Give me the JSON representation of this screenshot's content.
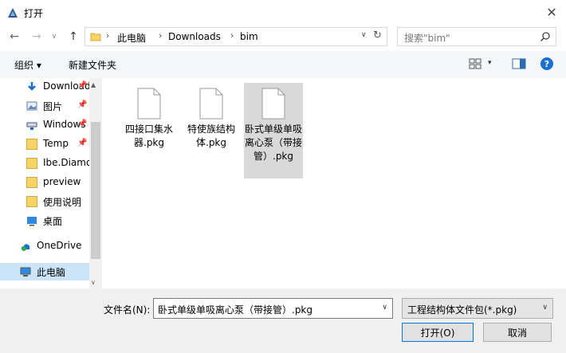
{
  "window": {
    "title": "打开",
    "close_glyph": "✕"
  },
  "nav": {
    "back_glyph": "←",
    "forward_glyph": "→",
    "history_glyph": "∨",
    "up_glyph": "↑",
    "breadcrumb": [
      "此电脑",
      "Downloads",
      "bim"
    ],
    "separator": "›",
    "dropdown_glyph": "∨",
    "refresh_glyph": "↻",
    "search_placeholder": "搜索\"bim\""
  },
  "toolbar": {
    "organize_label": "组织 ▾",
    "new_folder_label": "新建文件夹",
    "view_dropdown_glyph": "▾",
    "help_label": "?"
  },
  "sidebar": {
    "scroll_up_glyph": "▲",
    "scroll_down_glyph": "∨",
    "items": [
      {
        "label": "Downloads",
        "icon": "download-arrow-icon",
        "pinned": true
      },
      {
        "label": "图片",
        "icon": "pictures-icon",
        "pinned": true
      },
      {
        "label": "Windows",
        "icon": "network-drive-icon",
        "pinned": true
      },
      {
        "label": "Temp",
        "icon": "folder-icon",
        "pinned": true
      },
      {
        "label": "Ibe.Diamond",
        "icon": "folder-icon",
        "pinned": false
      },
      {
        "label": "preview",
        "icon": "folder-icon",
        "pinned": false
      },
      {
        "label": "使用说明",
        "icon": "folder-icon",
        "pinned": false
      },
      {
        "label": "桌面",
        "icon": "desktop-icon",
        "pinned": false
      },
      {
        "label": "OneDrive",
        "icon": "onedrive-icon",
        "pinned": false
      },
      {
        "label": "此电脑",
        "icon": "this-pc-icon",
        "pinned": false
      }
    ],
    "pin_glyph": "📌"
  },
  "files": [
    {
      "name": "四接口集水器.pkg",
      "selected": false
    },
    {
      "name": "特使族结构体.pkg",
      "selected": false
    },
    {
      "name": "卧式单级单吸离心泵（带接管）.pkg",
      "selected": true
    }
  ],
  "footer": {
    "filename_label": "文件名(N):",
    "filename_value": "卧式单级单吸离心泵（带接管）.pkg",
    "filter_value": "工程结构体文件包(*.pkg)",
    "dropdown_glyph": "∨",
    "open_label": "打开(O)",
    "cancel_label": "取消"
  },
  "colors": {
    "accent": "#0078d7",
    "selected_sidebar": "#cce4f7",
    "selected_file": "#d9d9d9",
    "help_blue": "#1a6fd1"
  }
}
